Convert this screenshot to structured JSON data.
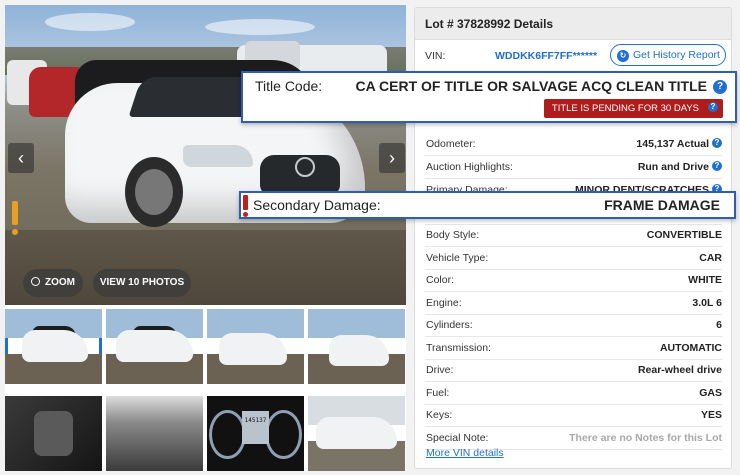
{
  "gallery": {
    "zoom_label": "ZOOM",
    "view_photos_label": "VIEW 10 PHOTOS",
    "prev_icon": "‹",
    "next_icon": "›",
    "odometer_thumb_text": "145137"
  },
  "details": {
    "header": "Lot # 37828992 Details",
    "vin_label": "VIN:",
    "vin_value": "WDDKK6FF7FF******",
    "history_button": "Get History Report",
    "rows": [
      {
        "label": "Odometer:",
        "value": "145,137 Actual",
        "info": true
      },
      {
        "label": "Auction Highlights:",
        "value": "Run and Drive",
        "info": true
      },
      {
        "label": "Primary Damage:",
        "value": "MINOR DENT/SCRATCHES",
        "info": true
      },
      {
        "label": "Secondary Damage:",
        "value": "FRAME DAMAGE",
        "info": false
      },
      {
        "label": "Body Style:",
        "value": "CONVERTIBLE",
        "info": false
      },
      {
        "label": "Vehicle Type:",
        "value": "CAR",
        "info": false
      },
      {
        "label": "Color:",
        "value": "WHITE",
        "info": false
      },
      {
        "label": "Engine:",
        "value": "3.0L 6",
        "info": false
      },
      {
        "label": "Cylinders:",
        "value": "6",
        "info": false
      },
      {
        "label": "Transmission:",
        "value": "AUTOMATIC",
        "info": false
      },
      {
        "label": "Drive:",
        "value": "Rear-wheel drive",
        "info": false
      },
      {
        "label": "Fuel:",
        "value": "GAS",
        "info": false
      },
      {
        "label": "Keys:",
        "value": "YES",
        "info": false
      },
      {
        "label": "Special Note:",
        "value": "There are no Notes for this Lot",
        "info": false
      }
    ],
    "more_link": "More VIN details"
  },
  "callouts": {
    "title_label": "Title Code:",
    "title_value": "CA CERT OF TITLE OR SALVAGE ACQ CLEAN TITLE",
    "pending_badge": "TITLE IS PENDING FOR 30 DAYS",
    "damage_label": "Secondary Damage:",
    "damage_value": "FRAME DAMAGE"
  },
  "colors": {
    "accent": "#1f6fd1",
    "callout_border": "#2d5fae",
    "pending_badge": "#b01c1c",
    "alert": "#c0201a",
    "warning": "#e8a020"
  }
}
